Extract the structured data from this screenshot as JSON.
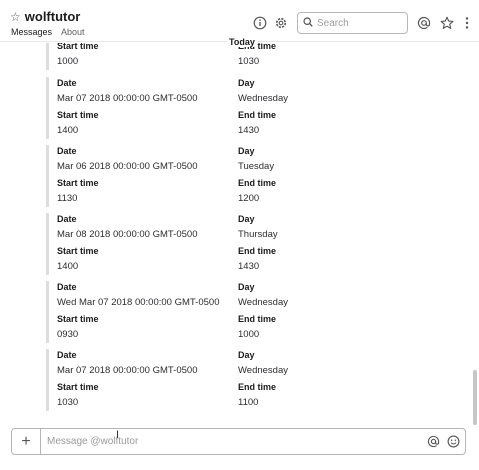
{
  "header": {
    "title": "wolftutor",
    "tabs": [
      {
        "label": "Messages"
      },
      {
        "label": "About"
      }
    ],
    "search_placeholder": "Search"
  },
  "divider": {
    "label": "Today"
  },
  "field_labels": {
    "date": "Date",
    "day": "Day",
    "start": "Start time",
    "end": "End time"
  },
  "partial_card": {
    "start_value": "1000",
    "end_label_partial": "End time",
    "end_value": "1030"
  },
  "cards": [
    {
      "date": "Mar 07 2018 00:00:00 GMT-0500",
      "day": "Wednesday",
      "start": "1400",
      "end": "1430"
    },
    {
      "date": "Mar 06 2018 00:00:00 GMT-0500",
      "day": "Tuesday",
      "start": "1130",
      "end": "1200"
    },
    {
      "date": "Mar 08 2018 00:00:00 GMT-0500",
      "day": "Thursday",
      "start": "1400",
      "end": "1430"
    },
    {
      "date": "Wed Mar 07 2018 00:00:00 GMT-0500",
      "day": "Wednesday",
      "start": "0930",
      "end": "1000"
    },
    {
      "date": "Mar 07 2018 00:00:00 GMT-0500",
      "day": "Wednesday",
      "start": "1030",
      "end": "1100"
    }
  ],
  "composer": {
    "placeholder": "Message @wolftutor"
  }
}
